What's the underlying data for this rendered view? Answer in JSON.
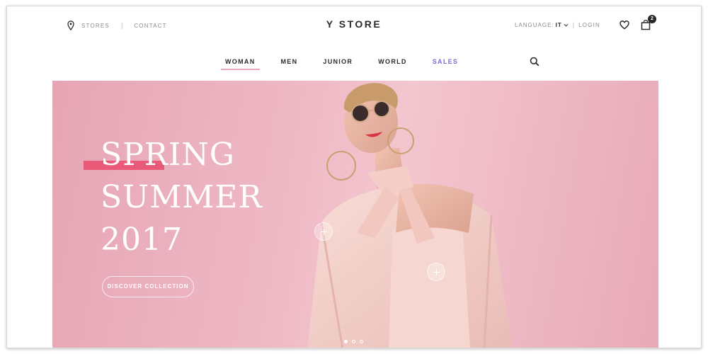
{
  "topbar": {
    "stores_label": "STORES",
    "contact_label": "CONTACT",
    "separator": "|",
    "logo": "Y STORE",
    "language_label": "LANGUAGE:",
    "language_value": "IT",
    "login_label": "LOGIN",
    "cart_count": "2",
    "icons": [
      "location-pin-icon",
      "chevron-down-icon",
      "heart-icon",
      "shopping-bag-icon"
    ]
  },
  "nav": {
    "items": [
      {
        "label": "WOMAN",
        "active": true
      },
      {
        "label": "MEN"
      },
      {
        "label": "JUNIOR"
      },
      {
        "label": "WORLD"
      },
      {
        "label": "SALES",
        "highlight": true
      }
    ],
    "search_icon": "search-icon"
  },
  "hero": {
    "title_lines": [
      "SPRING",
      "SUMMER",
      "2017"
    ],
    "cta_label": "DISCOVER COLLECTION",
    "slide_count": 3,
    "active_slide": 1,
    "colors": {
      "background": "#efb9c5",
      "accent": "#e85a78",
      "sales": "#7c6cd6"
    }
  }
}
